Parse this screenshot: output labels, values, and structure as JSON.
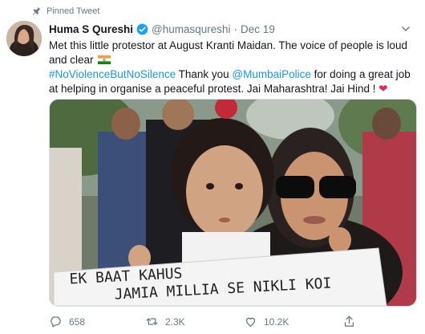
{
  "pinned": {
    "label": "Pinned Tweet",
    "icon": "pin-icon"
  },
  "tweet": {
    "display_name": "Huma S Qureshi",
    "handle": "@humasqureshi",
    "separator": "·",
    "date": "Dec 19",
    "line1": "Met this little protestor at August Kranti Maidan. The voice of people is loud and clear",
    "hashtag": "#NoViolenceButNoSilence",
    "text2": " Thank you ",
    "mention": "@MumbaiPolice",
    "text3": " for doing a great job at helping in organise a peaceful protest. Jai Maharashtra! Jai Hind ! ",
    "heart": "❤",
    "photo_sign": {
      "line1": "EK BAAT KAHUS",
      "line2": "JAMIA MILLIA SE NIKLI KOI"
    }
  },
  "actions": {
    "reply_count": "658",
    "retweet_count": "2.3K",
    "like_count": "10.2K"
  },
  "colors": {
    "link": "#1b95e0",
    "muted": "#657786",
    "heart": "#e0245e",
    "verified": "#1da1f2"
  }
}
